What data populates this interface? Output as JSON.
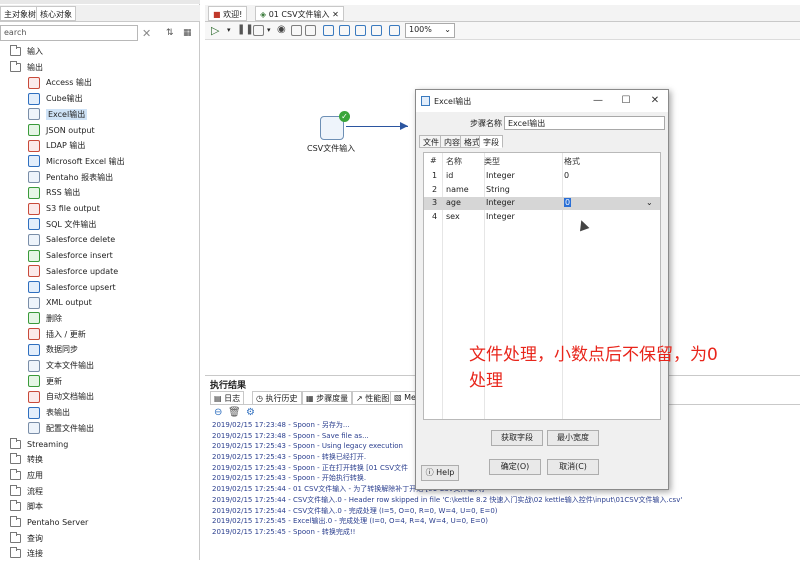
{
  "left_panel": {
    "tabs": [
      "主对象树",
      "核心对象"
    ],
    "search_placeholder": "earch",
    "tree": [
      {
        "label": "输入",
        "type": "folder"
      },
      {
        "label": "输出",
        "type": "folder"
      },
      {
        "label": "Access 输出",
        "type": "step"
      },
      {
        "label": "Cube输出",
        "type": "step"
      },
      {
        "label": "Excel输出",
        "type": "step",
        "selected": true
      },
      {
        "label": "JSON output",
        "type": "step"
      },
      {
        "label": "LDAP 输出",
        "type": "step"
      },
      {
        "label": "Microsoft Excel 输出",
        "type": "step"
      },
      {
        "label": "Pentaho 报表输出",
        "type": "step"
      },
      {
        "label": "RSS 输出",
        "type": "step"
      },
      {
        "label": "S3 file output",
        "type": "step"
      },
      {
        "label": "SQL 文件输出",
        "type": "step"
      },
      {
        "label": "Salesforce delete",
        "type": "step"
      },
      {
        "label": "Salesforce insert",
        "type": "step"
      },
      {
        "label": "Salesforce update",
        "type": "step"
      },
      {
        "label": "Salesforce upsert",
        "type": "step"
      },
      {
        "label": "XML output",
        "type": "step"
      },
      {
        "label": "删除",
        "type": "step"
      },
      {
        "label": "插入 / 更新",
        "type": "step"
      },
      {
        "label": "数据同步",
        "type": "step"
      },
      {
        "label": "文本文件输出",
        "type": "step"
      },
      {
        "label": "更新",
        "type": "step"
      },
      {
        "label": "自动文档输出",
        "type": "step"
      },
      {
        "label": "表输出",
        "type": "step"
      },
      {
        "label": "配置文件输出",
        "type": "step"
      },
      {
        "label": "Streaming",
        "type": "folder"
      },
      {
        "label": "转换",
        "type": "folder"
      },
      {
        "label": "应用",
        "type": "folder"
      },
      {
        "label": "流程",
        "type": "folder"
      },
      {
        "label": "脚本",
        "type": "folder"
      },
      {
        "label": "Pentaho Server",
        "type": "folder"
      },
      {
        "label": "查询",
        "type": "folder"
      },
      {
        "label": "连接",
        "type": "folder"
      }
    ]
  },
  "editor_tabs": [
    "欢迎!",
    "01 CSV文件输入"
  ],
  "toolbar": {
    "zoom": "100%"
  },
  "canvas": {
    "step_label": "CSV文件输入"
  },
  "exec": {
    "title": "执行结果",
    "tabs": [
      "日志",
      "执行历史",
      "步骤度量",
      "性能图",
      "Me"
    ],
    "log": [
      "2019/02/15 17:23:48 - Spoon - 另存为...",
      "2019/02/15 17:23:48 - Spoon - Save file as...",
      "2019/02/15 17:25:43 - Spoon - Using legacy execution",
      "2019/02/15 17:25:43 - Spoon - 转换已经打开.",
      "2019/02/15 17:25:43 - Spoon - 正在打开转换 [01 CSV文件",
      "2019/02/15 17:25:43 - Spoon - 开始执行转换.",
      "2019/02/15 17:25:44 - 01 CSV文件输入 - 为了转换解除补丁开始  [01 CSV文件输入]",
      "2019/02/15 17:25:44 - CSV文件输入.0 - Header row skipped in file 'C:\\kettle 8.2 快速入门实战\\02 kettle输入控件\\input\\01CSV文件输入.csv'",
      "2019/02/15 17:25:44 - CSV文件输入.0 - 完成处理 (I=5, O=0, R=0, W=4, U=0, E=0)",
      "2019/02/15 17:25:45 - Excel输出.0 - 完成处理 (I=0, O=4, R=4, W=4, U=0, E=0)",
      "2019/02/15 17:25:45 - Spoon - 转换完成!!"
    ]
  },
  "dialog": {
    "title": "Excel输出",
    "stepname_label": "步骤名称",
    "stepname_value": "Excel输出",
    "tabs": [
      "文件",
      "内容",
      "格式",
      "字段"
    ],
    "grid_headers": [
      "#",
      "名称",
      "类型",
      "格式"
    ],
    "rows": [
      {
        "n": "1",
        "name": "id",
        "type": "Integer",
        "format": "0"
      },
      {
        "n": "2",
        "name": "name",
        "type": "String",
        "format": ""
      },
      {
        "n": "3",
        "name": "age",
        "type": "Integer",
        "format": "0"
      },
      {
        "n": "4",
        "name": "sex",
        "type": "Integer",
        "format": ""
      }
    ],
    "btn_get_fields": "获取字段",
    "btn_min_width": "最小宽度",
    "btn_help": "Help",
    "btn_ok": "确定(O)",
    "btn_cancel": "取消(C)"
  },
  "overlay_note": [
    "文件处理，小数点后不保留，为0",
    "处理"
  ]
}
